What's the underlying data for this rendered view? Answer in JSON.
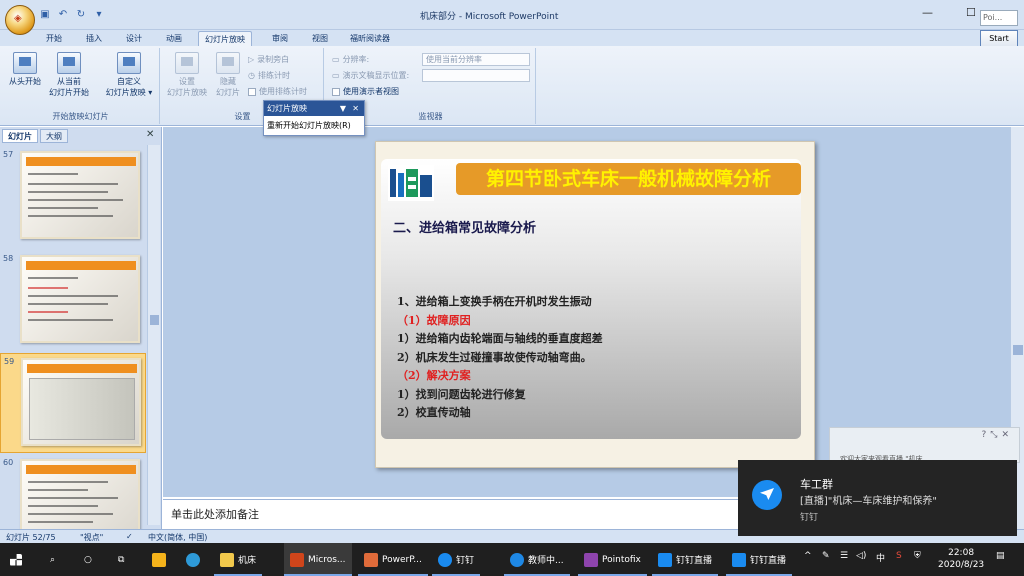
{
  "window": {
    "title": "机床部分 - Microsoft PowerPoint",
    "min": "—",
    "max": "☐",
    "close": "✕",
    "search_partial": "Poi...",
    "start_button": "Start"
  },
  "tabs": [
    "开始",
    "插入",
    "设计",
    "动画",
    "幻灯片放映",
    "审阅",
    "视图",
    "福昕阅读器"
  ],
  "active_tab": "幻灯片放映",
  "ribbon": {
    "group1": {
      "label": "开始放映幻灯片",
      "btn_from_start": "从头开始",
      "btn_from_current_1": "从当前",
      "btn_from_current_2": "幻灯片开始",
      "btn_custom_1": "自定义",
      "btn_custom_2": "幻灯片放映 ▾"
    },
    "group2": {
      "label": "设置",
      "btn_setup_1": "设置",
      "btn_setup_2": "幻灯片放映",
      "btn_hide_1": "隐藏",
      "btn_hide_2": "幻灯片",
      "record": "录制旁白",
      "rehearse": "排练计时",
      "use_timing": "使用排练计时"
    },
    "group3": {
      "label": "监视器",
      "resolution_label": "分辨率:",
      "resolution_value": "使用当前分辨率",
      "show_on_label": "演示文稿显示位置:",
      "presenter_view": "使用演示者视图"
    }
  },
  "popup": {
    "title": "幻灯片放映",
    "item": "重新开始幻灯片放映(R)"
  },
  "left_panel": {
    "tab_slides": "幻灯片",
    "tab_outline": "大纲",
    "thumbnails": [
      "57",
      "58",
      "59",
      "60"
    ]
  },
  "slide": {
    "title": "第四节卧式车床一般机械故障分析",
    "subtitle": "二、进给箱常见故障分析",
    "lines": [
      {
        "text": "1、进给箱上变换手柄在开机时发生振动",
        "red": false
      },
      {
        "text": "（1）故障原因",
        "red": true
      },
      {
        "text": "1）进给箱内齿轮端面与轴线的垂直度超差",
        "red": false
      },
      {
        "text": "2）机床发生过碰撞事故使传动轴弯曲。",
        "red": false
      },
      {
        "text": "（2）解决方案",
        "red": true
      },
      {
        "text": "1）找到问题齿轮进行修复",
        "red": false
      },
      {
        "text": "2）校直传动轴",
        "red": false
      }
    ]
  },
  "notes_placeholder": "单击此处添加备注",
  "status": {
    "slide_count": "幻灯片 52/75",
    "theme": "\"视点\"",
    "language": "中文(简体, 中国)"
  },
  "notification_small": {
    "text": "欢迎大家来观看直播 \"机床"
  },
  "notification": {
    "title": "车工群",
    "message": "[直播]\"机床—车床维护和保养\"",
    "app": "钉钉"
  },
  "taskbar": {
    "items": [
      "机床",
      "Micros...",
      "PowerP...",
      "钉钉",
      "教师中...",
      "Pointofix",
      "钉钉直播",
      "钉钉直播"
    ],
    "ime": "中",
    "time": "22:08",
    "date": "2020/8/23"
  },
  "colors": {
    "ribbon_bg": "#dbe6f4",
    "slide_title_bg": "#e69a28",
    "slide_title_text": "#fff200",
    "accent_red": "#e02020",
    "taskbar_bg": "#1f1f1f"
  }
}
